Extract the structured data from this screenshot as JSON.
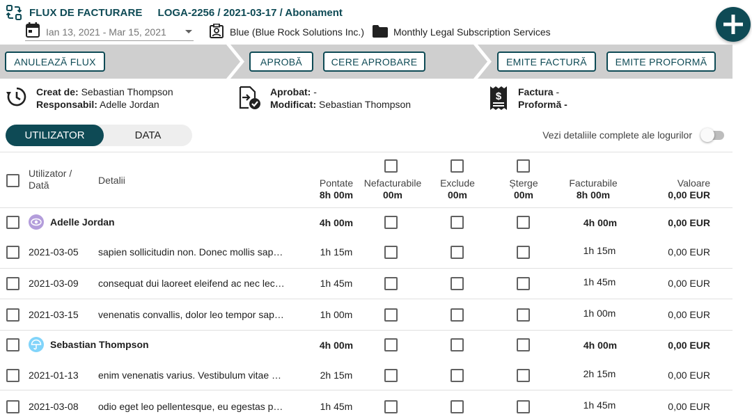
{
  "header": {
    "app_name": "FLUX DE FACTURARE",
    "reference": "LOGA-2256 / 2021-03-17 / Abonament",
    "date_range": "Ian 13, 2021 - Mar 15, 2021",
    "client": "Blue (Blue Rock Solutions Inc.)",
    "service": "Monthly Legal Subscription Services"
  },
  "steps": {
    "cancel_label": "ANULEAZĂ FLUX",
    "approve_label": "APROBĂ",
    "request_approval_label": "CERE APROBARE",
    "issue_invoice_label": "EMITE FACTURĂ",
    "issue_proforma_label": "EMITE PROFORMĂ"
  },
  "info": {
    "created_by_label": "Creat de:",
    "created_by_value": "Sebastian Thompson",
    "responsible_label": "Responsabil:",
    "responsible_value": "Adelle Jordan",
    "approved_label": "Aprobat:",
    "approved_value": "-",
    "modified_label": "Modificat:",
    "modified_value": "Sebastian Thompson",
    "invoice_label": "Factura",
    "invoice_value": "-",
    "proforma_label": "Proformă",
    "proforma_value": "-"
  },
  "view_toggle": {
    "user_label": "UTILIZATOR",
    "date_label": "DATA",
    "selected": "UTILIZATOR"
  },
  "log_toggle": {
    "label": "Vezi detaliile complete ale logurilor",
    "on": false
  },
  "table": {
    "headers": {
      "user_date_line1": "Utilizator /",
      "user_date_line2": "Dată",
      "details": "Detalii",
      "logged": "Pontate",
      "logged_total": "8h 00m",
      "nonbillable": "Nefacturabile",
      "nonbillable_total": "00m",
      "exclude": "Exclude",
      "exclude_total": "00m",
      "delete": "Șterge",
      "delete_total": "00m",
      "billable": "Facturabile",
      "billable_total": "8h 00m",
      "value": "Valoare",
      "value_total": "0,00 EUR"
    },
    "groups": [
      {
        "user": "Adelle Jordan",
        "logged": "4h 00m",
        "billable": "4h 00m",
        "value": "0,00 EUR",
        "entries": [
          {
            "date": "2021-03-05",
            "details": "sapien sollicitudin non. Donec mollis sap…",
            "logged": "1h 15m",
            "billable": "1h 15m",
            "value": "0,00 EUR"
          },
          {
            "date": "2021-03-09",
            "details": "consequat dui laoreet eleifend ac nec lec…",
            "logged": "1h 45m",
            "billable": "1h 45m",
            "value": "0,00 EUR"
          },
          {
            "date": "2021-03-15",
            "details": "venenatis convallis, dolor leo tempor sap…",
            "logged": "1h 00m",
            "billable": "1h 00m",
            "value": "0,00 EUR"
          }
        ]
      },
      {
        "user": "Sebastian Thompson",
        "logged": "4h 00m",
        "billable": "4h 00m",
        "value": "0,00 EUR",
        "entries": [
          {
            "date": "2021-01-13",
            "details": "enim venenatis varius. Vestibulum vitae …",
            "logged": "2h 15m",
            "billable": "2h 15m",
            "value": "0,00 EUR"
          },
          {
            "date": "2021-03-08",
            "details": "odio eget leo pellentesque, eu egestas p…",
            "logged": "1h 45m",
            "billable": "1h 45m",
            "value": "0,00 EUR"
          }
        ]
      }
    ]
  },
  "colors": {
    "primary": "#0e4a55",
    "stepbar": "#cfcfcf",
    "avatar_adelle": "#b39ddb",
    "avatar_sebastian": "#81d4fa"
  }
}
